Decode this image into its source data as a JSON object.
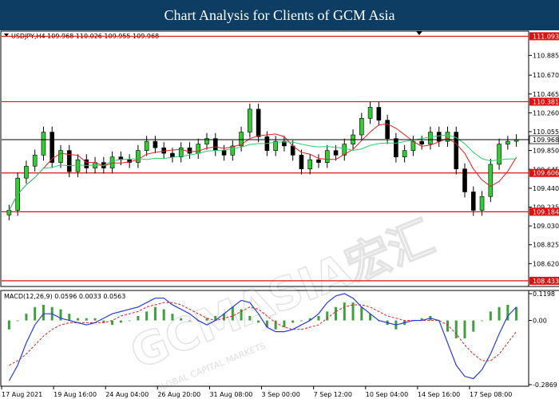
{
  "header": {
    "title": "Chart Analysis for Clients of GCM Asia"
  },
  "watermark": {
    "brand": "GCMASIA宏汇",
    "sub": "GLOBAL CAPITAL MARKETS"
  },
  "chart_data": {
    "type": "candlestick",
    "symbol_info": "USDJPY,H4  109.968 110.026 109.955 109.968",
    "price_axis": {
      "ylim": [
        108.38,
        111.14
      ],
      "ticks": [
        "110.885",
        "110.670",
        "110.465",
        "110.260",
        "110.055",
        "109.850",
        "109.645",
        "109.440",
        "109.235",
        "109.030",
        "108.825",
        "108.620"
      ]
    },
    "current_price": {
      "label": "109.968",
      "value": 109.968
    },
    "levels": [
      {
        "label": "111.093",
        "value": 111.093
      },
      {
        "label": "110.381",
        "value": 110.381
      },
      {
        "label": "109.606",
        "value": 109.606
      },
      {
        "label": "109.184",
        "value": 109.184
      },
      {
        "label": "108.433",
        "value": 108.433
      }
    ],
    "x_labels": [
      "17 Aug 2021",
      "19 Aug 16:00",
      "24 Aug 04:00",
      "26 Aug 20:00",
      "31 Aug 08:00",
      "3 Sep 00:00",
      "7 Sep 12:00",
      "10 Sep 04:00",
      "14 Sep 16:00",
      "17 Sep 08:00"
    ],
    "closes": [
      109.2,
      109.55,
      109.68,
      109.8,
      110.05,
      109.72,
      109.85,
      109.62,
      109.75,
      109.66,
      109.72,
      109.66,
      109.78,
      109.75,
      109.72,
      109.85,
      109.95,
      109.88,
      109.82,
      109.78,
      109.88,
      109.82,
      109.92,
      109.98,
      109.85,
      109.8,
      109.9,
      110.05,
      110.3,
      110.0,
      109.85,
      109.95,
      109.9,
      109.8,
      109.65,
      109.75,
      109.72,
      109.85,
      109.8,
      109.92,
      110.02,
      110.2,
      110.32,
      110.18,
      109.98,
      109.78,
      109.85,
      109.95,
      109.92,
      110.05,
      109.95,
      110.05,
      109.65,
      109.4,
      109.2,
      109.35,
      109.7,
      109.92,
      109.95,
      109.968
    ],
    "macd": {
      "label": "MACD(12,26,9) 0.0596 0.0033 0.0563",
      "ylim": [
        -0.2869,
        0.1198
      ],
      "ticks": [
        "0.1198",
        "0.00",
        "-0.2869"
      ],
      "histogram": [
        -0.04,
        0.0,
        0.03,
        0.06,
        0.07,
        0.06,
        0.05,
        0.03,
        0.01,
        0.01,
        0.01,
        -0.01,
        -0.02,
        -0.01,
        0.0,
        0.02,
        0.04,
        0.06,
        0.05,
        0.03,
        0.01,
        0.0,
        0.0,
        0.01,
        0.02,
        0.03,
        0.06,
        0.05,
        0.02,
        -0.01,
        -0.03,
        -0.04,
        -0.03,
        -0.01,
        0.0,
        0.01,
        0.02,
        0.04,
        0.06,
        0.08,
        0.08,
        0.06,
        0.03,
        0.0,
        -0.02,
        -0.04,
        -0.02,
        0.0,
        0.01,
        0.02,
        0.0,
        -0.05,
        -0.08,
        -0.08,
        -0.05,
        0.0,
        0.04,
        0.06,
        0.07,
        0.06
      ],
      "macd_line": [
        -0.27,
        -0.2,
        -0.1,
        -0.02,
        0.03,
        0.03,
        0.01,
        0.0,
        -0.01,
        -0.02,
        -0.01,
        0.01,
        0.03,
        0.04,
        0.05,
        0.06,
        0.08,
        0.1,
        0.1,
        0.07,
        0.05,
        0.03,
        0.0,
        -0.02,
        0.0,
        0.03,
        0.06,
        0.09,
        0.08,
        0.03,
        -0.03,
        -0.05,
        -0.05,
        -0.04,
        -0.02,
        0.0,
        0.03,
        0.08,
        0.11,
        0.12,
        0.1,
        0.06,
        0.03,
        0.0,
        -0.01,
        -0.02,
        -0.01,
        0.0,
        0.0,
        0.01,
        0.0,
        -0.1,
        -0.2,
        -0.25,
        -0.26,
        -0.22,
        -0.15,
        -0.06,
        0.02,
        0.06
      ],
      "signal_line": [
        -0.2,
        -0.18,
        -0.15,
        -0.11,
        -0.07,
        -0.04,
        -0.02,
        -0.01,
        -0.01,
        -0.01,
        -0.01,
        -0.01,
        0.0,
        0.02,
        0.03,
        0.04,
        0.06,
        0.07,
        0.08,
        0.08,
        0.07,
        0.05,
        0.03,
        0.01,
        0.0,
        0.01,
        0.02,
        0.04,
        0.06,
        0.05,
        0.02,
        -0.01,
        -0.03,
        -0.04,
        -0.04,
        -0.03,
        -0.02,
        0.01,
        0.04,
        0.06,
        0.07,
        0.07,
        0.06,
        0.04,
        0.02,
        0.01,
        0.0,
        0.0,
        0.0,
        0.0,
        0.0,
        -0.02,
        -0.06,
        -0.11,
        -0.15,
        -0.18,
        -0.18,
        -0.15,
        -0.1,
        -0.05
      ]
    },
    "colors": {
      "bull": "#32cd32",
      "bear": "#000000",
      "level": "#e01010",
      "ma_fast": "#e02020",
      "ma_slow": "#2ecc71",
      "macd_line": "#2a3bdc",
      "signal_line": "#e02020",
      "histogram": "#3ca03c"
    }
  }
}
